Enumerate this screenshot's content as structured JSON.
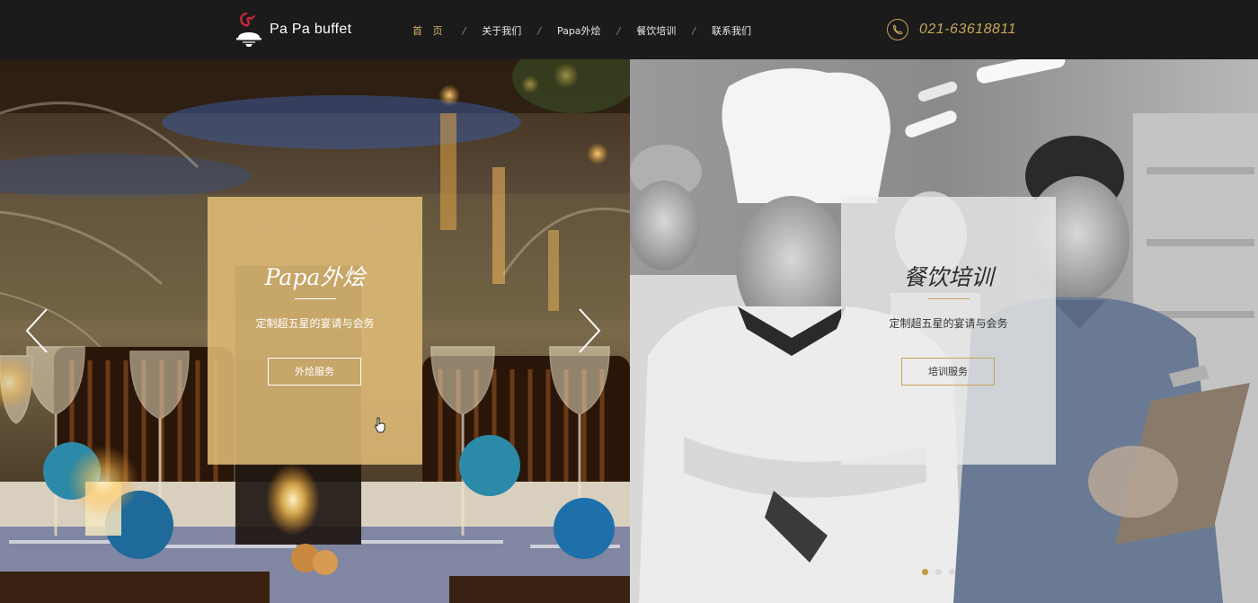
{
  "brand": {
    "name": "Pa Pa buffet",
    "logo_icon": "cloche-with-pepper-icon",
    "logo_color": "#c8283a"
  },
  "nav": {
    "items": [
      {
        "label": "首 页",
        "active": true
      },
      {
        "label": "关于我们",
        "active": false
      },
      {
        "label": "Papa外烩",
        "active": false
      },
      {
        "label": "餐饮培训",
        "active": false
      },
      {
        "label": "联系我们",
        "active": false
      }
    ],
    "separator": "/"
  },
  "contact": {
    "phone": "021-63618811",
    "icon": "phone-circle-icon"
  },
  "banner": {
    "left": {
      "title": "Papa外烩",
      "subtitle": "定制超五星的宴请与会务",
      "button": "外烩服务",
      "image": "candle-lit dining table by fountain"
    },
    "right": {
      "title": "餐饮培训",
      "subtitle": "定制超五星的宴请与会务",
      "button": "培训服务",
      "image": "smiling chefs and staff in kitchen"
    },
    "prev_icon": "chevron-left-icon",
    "next_icon": "chevron-right-icon"
  },
  "colors": {
    "header_bg": "#1b1b1b",
    "accent_gold": "#c9a45a",
    "card_gold": "#e2be78"
  }
}
